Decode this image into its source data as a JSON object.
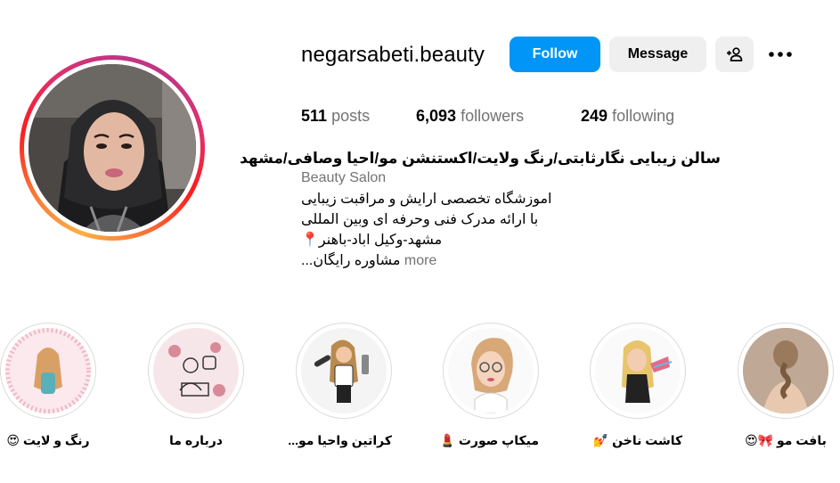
{
  "profile": {
    "username": "negarsabeti.beauty",
    "follow_label": "Follow",
    "message_label": "Message"
  },
  "stats": {
    "posts_count": "511",
    "posts_label": "posts",
    "followers_count": "6,093",
    "followers_label": "followers",
    "following_count": "249",
    "following_label": "following"
  },
  "bio": {
    "name": "سالن زیبایی نگارثابتی/رنگ ولایت/اکستنشن مو/احیا وصافی/مشهد",
    "category": "Beauty Salon",
    "line1": "اموزشگاه تخصصی ارایش و مراقبت زیبایی",
    "line2": "با ارائه مدرک فنی وحرفه ای وبین المللی",
    "line3": "مشهد-وکیل اباد-باهنر📍",
    "line4": "مشاوره رایگان...",
    "more_label": "more"
  },
  "highlights": [
    {
      "label": "رنگ و لایت",
      "emoji": "😍"
    },
    {
      "label": "درباره ما",
      "emoji": ""
    },
    {
      "label": "کراتین واحیا مو...",
      "emoji": ""
    },
    {
      "label": "میکاپ صورت",
      "emoji": "💄"
    },
    {
      "label": "کاشت ناخن",
      "emoji": "💅"
    },
    {
      "label": "بافت مو",
      "emoji": "🎀😍"
    }
  ],
  "colors": {
    "follow_button": "#0095f6",
    "secondary_button": "#efefef",
    "muted_text": "#737373"
  }
}
